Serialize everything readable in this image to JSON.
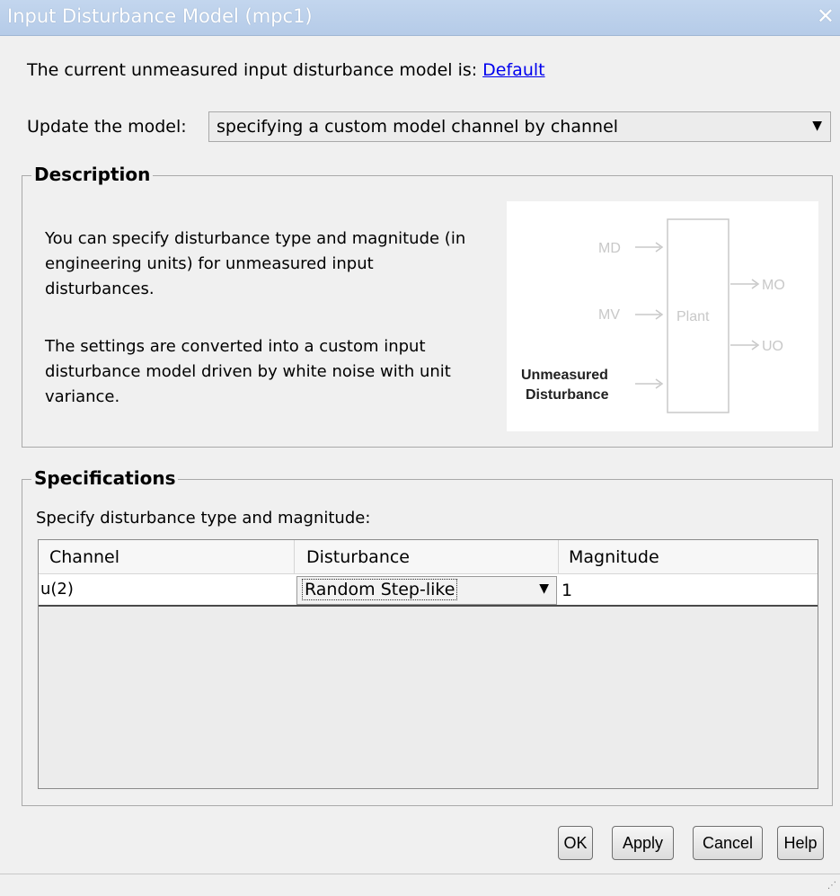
{
  "window": {
    "title": "Input Disturbance Model (mpc1)",
    "close_glyph": "✕"
  },
  "current_model": {
    "label": "The current unmeasured input disturbance model is:",
    "link": "Default"
  },
  "update": {
    "label": "Update the model:",
    "selected": "specifying a custom model channel by channel"
  },
  "description": {
    "legend": "Description",
    "p1": "You can specify disturbance type and magnitude (in engineering units) for unmeasured input disturbances.",
    "p2": "The settings are converted into a custom input disturbance model driven by white noise with unit variance.",
    "diagram": {
      "md": "MD",
      "mv": "MV",
      "plant": "Plant",
      "mo": "MO",
      "uo": "UO",
      "ud_line1": "Unmeasured",
      "ud_line2": "Disturbance"
    }
  },
  "specifications": {
    "legend": "Specifications",
    "label": "Specify disturbance type and magnitude:",
    "columns": [
      "Channel",
      "Disturbance",
      "Magnitude"
    ],
    "rows": [
      {
        "channel": "u(2)",
        "disturbance": "Random Step-like",
        "magnitude": "1"
      }
    ]
  },
  "buttons": {
    "ok": "OK",
    "apply": "Apply",
    "cancel": "Cancel",
    "help": "Help"
  }
}
